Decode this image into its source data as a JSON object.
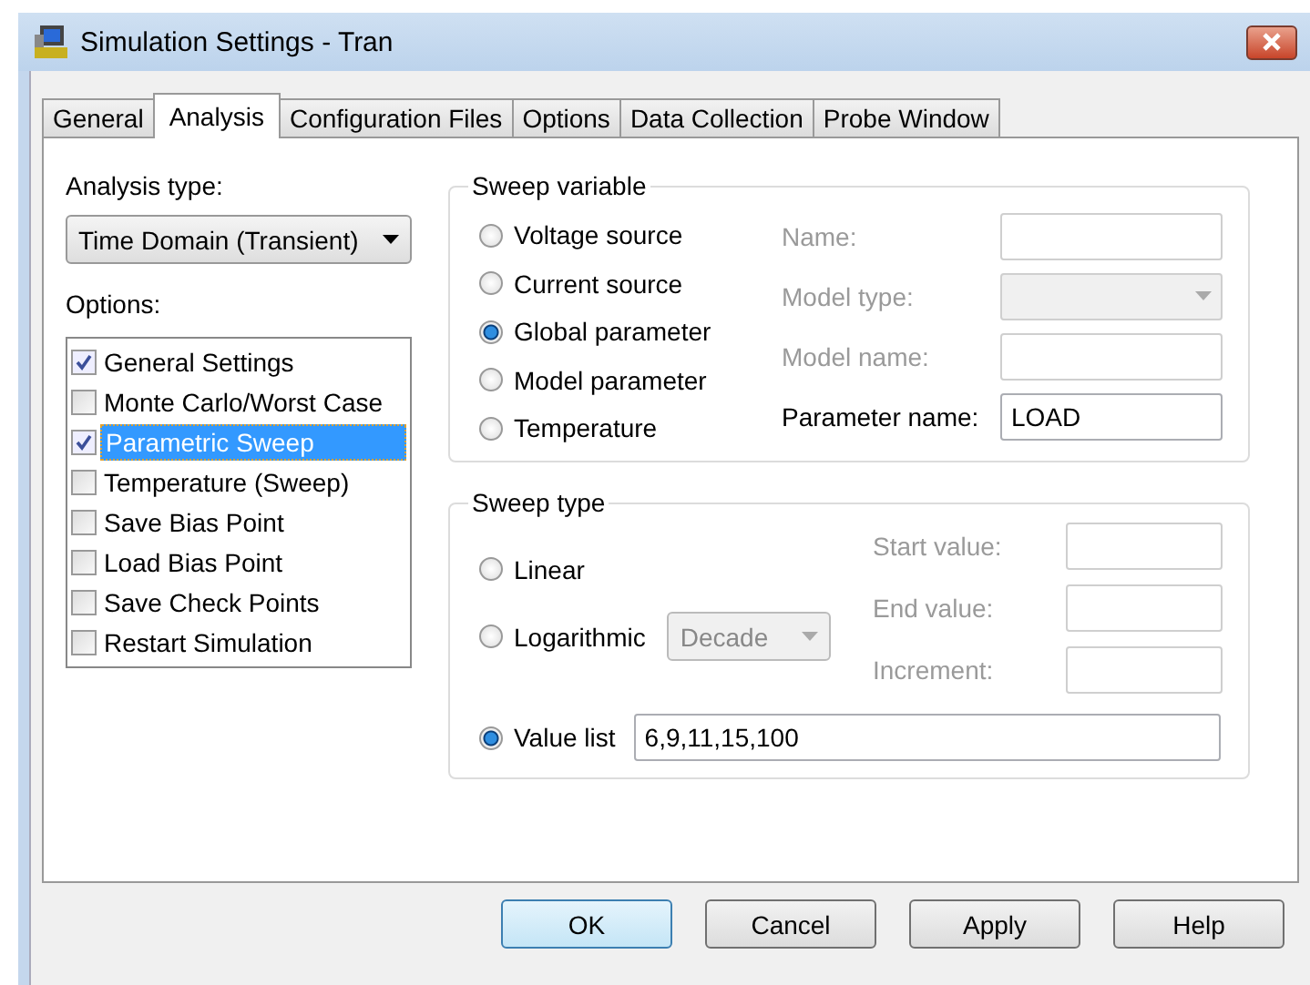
{
  "window": {
    "title": "Simulation Settings - Tran"
  },
  "tabs": [
    {
      "label": "General",
      "selected": false
    },
    {
      "label": "Analysis",
      "selected": true
    },
    {
      "label": "Configuration Files",
      "selected": false
    },
    {
      "label": "Options",
      "selected": false
    },
    {
      "label": "Data Collection",
      "selected": false
    },
    {
      "label": "Probe Window",
      "selected": false
    }
  ],
  "analysis_type": {
    "label": "Analysis type:",
    "value": "Time Domain (Transient)"
  },
  "options": {
    "label": "Options:",
    "items": [
      {
        "label": "General Settings",
        "checked": true,
        "selected": false
      },
      {
        "label": "Monte Carlo/Worst Case",
        "checked": false,
        "selected": false
      },
      {
        "label": "Parametric Sweep",
        "checked": true,
        "selected": true
      },
      {
        "label": "Temperature (Sweep)",
        "checked": false,
        "selected": false
      },
      {
        "label": "Save Bias Point",
        "checked": false,
        "selected": false
      },
      {
        "label": "Load Bias Point",
        "checked": false,
        "selected": false
      },
      {
        "label": "Save Check Points",
        "checked": false,
        "selected": false
      },
      {
        "label": "Restart Simulation",
        "checked": false,
        "selected": false
      }
    ]
  },
  "sweep_variable": {
    "title": "Sweep variable",
    "choices": [
      {
        "label": "Voltage source",
        "selected": false
      },
      {
        "label": "Current source",
        "selected": false
      },
      {
        "label": "Global parameter",
        "selected": true
      },
      {
        "label": "Model parameter",
        "selected": false
      },
      {
        "label": "Temperature",
        "selected": false
      }
    ],
    "fields": [
      {
        "kind": "text",
        "label": "Name:",
        "disabled": true
      },
      {
        "kind": "dropdown",
        "label": "Model type:",
        "disabled": true
      },
      {
        "kind": "text",
        "label": "Model name:",
        "disabled": true
      },
      {
        "kind": "text",
        "label": "Parameter name:",
        "value": "LOAD",
        "disabled": false
      }
    ]
  },
  "sweep_type": {
    "title": "Sweep type",
    "choices": [
      {
        "kind": "plain",
        "label": "Linear",
        "selected": false
      },
      {
        "kind": "dropdown",
        "label": "Logarithmic",
        "selected": false,
        "dropdown": {
          "value": "Decade",
          "disabled": true
        }
      },
      {
        "kind": "input",
        "label": "Value list",
        "selected": true,
        "value": "6,9,11,15,100"
      }
    ],
    "fields": [
      {
        "label": "Start value:",
        "disabled": true
      },
      {
        "label": "End value:",
        "disabled": true
      },
      {
        "label": "Increment:",
        "disabled": true
      }
    ]
  },
  "buttons": [
    {
      "label": "OK",
      "default": true
    },
    {
      "label": "Cancel",
      "default": false
    },
    {
      "label": "Apply",
      "default": false
    },
    {
      "label": "Help",
      "default": false
    }
  ]
}
